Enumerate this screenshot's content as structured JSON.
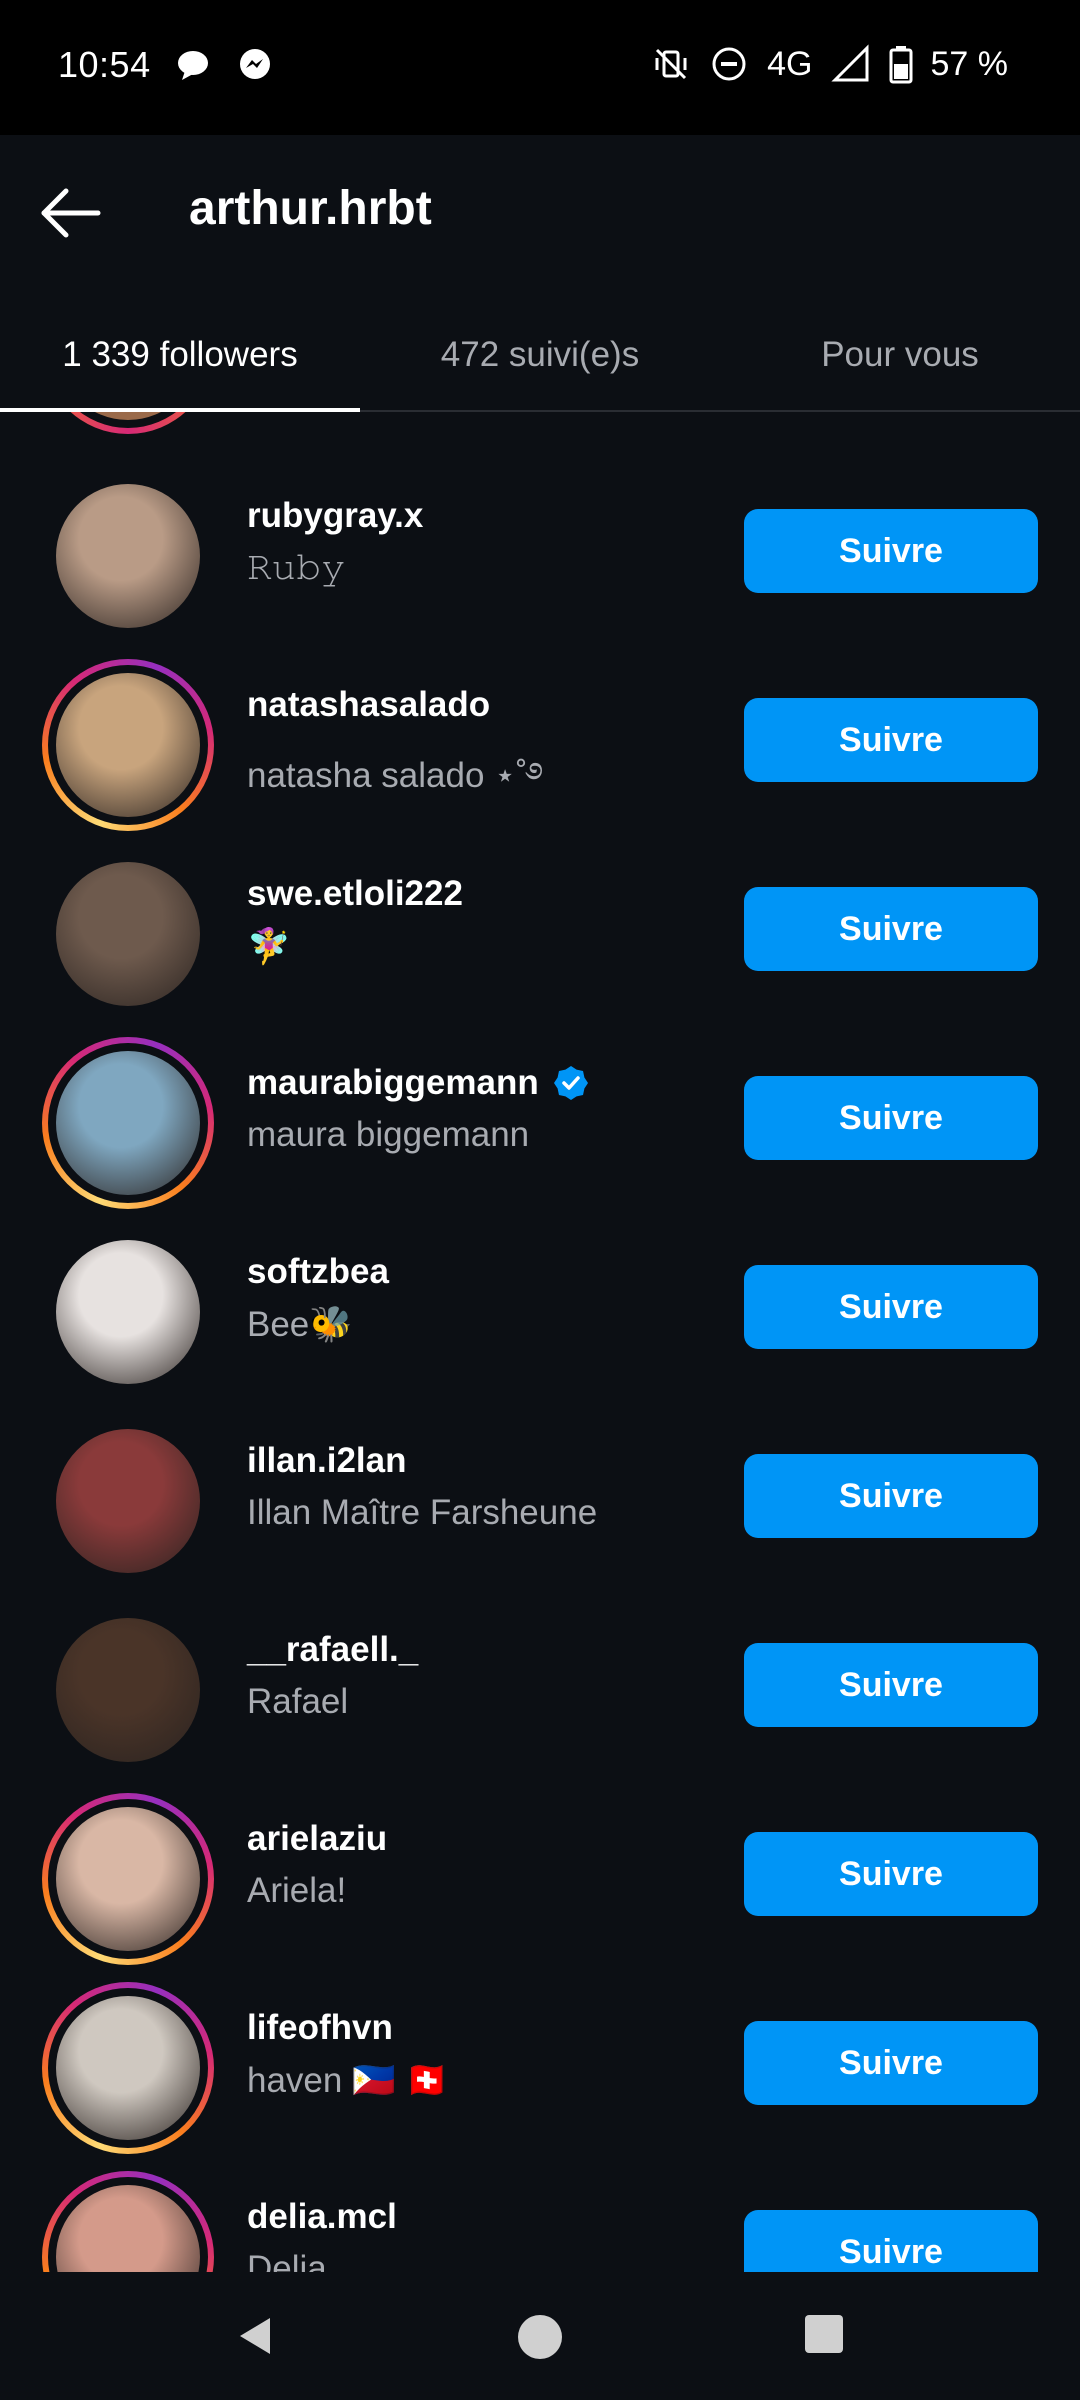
{
  "status_bar": {
    "time": "10:54",
    "network": "4G",
    "battery": "57 %",
    "left_icons": [
      "chat-bubble-icon",
      "messenger-icon"
    ],
    "right_icons": [
      "vibrate-off-icon",
      "do-not-disturb-icon",
      "signal-icon",
      "battery-icon"
    ]
  },
  "header": {
    "back_icon": "arrow-left-icon",
    "title": "arthur.hrbt"
  },
  "tabs": [
    {
      "label": "1 339 followers",
      "active": true
    },
    {
      "label": "472 suivi(e)s",
      "active": false
    },
    {
      "label": "Pour vous",
      "active": false
    }
  ],
  "follow_label": "Suivre",
  "followers": [
    {
      "username": "rubygray.x",
      "name": "𝚁𝚞𝚋𝚢",
      "story_ring": false,
      "verified": false,
      "avatar_color": "#b99b86"
    },
    {
      "username": "natashasalado",
      "name": "natasha salado ⋆˚࿔",
      "story_ring": true,
      "verified": false,
      "avatar_color": "#c8a47d"
    },
    {
      "username": "swe.etloli222",
      "name": "🧚‍♀️",
      "story_ring": false,
      "verified": false,
      "avatar_color": "#6e5a4d"
    },
    {
      "username": "maurabiggemann",
      "name": "maura biggemann",
      "story_ring": true,
      "verified": true,
      "avatar_color": "#7fa7c0"
    },
    {
      "username": "softzbea",
      "name": "Bee🐝",
      "story_ring": false,
      "verified": false,
      "avatar_color": "#e7e2e0"
    },
    {
      "username": "illan.i2lan",
      "name": "Illan Maître Farsheune",
      "story_ring": false,
      "verified": false,
      "avatar_color": "#8a3a3a"
    },
    {
      "username": "__rafaell._",
      "name": "Rafael",
      "story_ring": false,
      "verified": false,
      "avatar_color": "#4a3428"
    },
    {
      "username": "arielaziu",
      "name": "Ariela!",
      "story_ring": true,
      "verified": false,
      "avatar_color": "#d9b7a5"
    },
    {
      "username": "lifeofhvn",
      "name": "haven 🇵🇭 🇨🇭",
      "story_ring": true,
      "verified": false,
      "avatar_color": "#cfc8c0"
    },
    {
      "username": "delia.mcl",
      "name": "Delia",
      "story_ring": true,
      "verified": false,
      "avatar_color": "#d49a8a"
    }
  ],
  "nav": {
    "back_icon": "nav-back-triangle-icon",
    "home_icon": "nav-home-circle-icon",
    "recents_icon": "nav-recents-square-icon"
  },
  "colors": {
    "background": "#0c0f14",
    "accent": "#0095f6",
    "secondary_text": "#a8abb1"
  }
}
